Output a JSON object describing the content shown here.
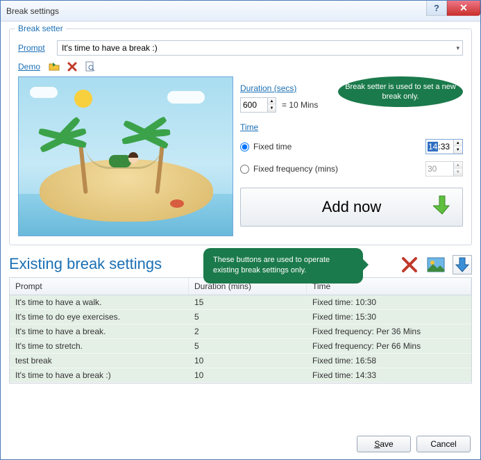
{
  "window": {
    "title": "Break settings"
  },
  "break_setter": {
    "legend": "Break setter",
    "prompt_label": "Prompt",
    "prompt_value": "It's time to have a break :)",
    "demo_label": "Demo",
    "duration_label": "Duration (secs)",
    "duration_value": "600",
    "duration_eq": "= 10 Mins",
    "time_label": "Time",
    "fixed_time_label": "Fixed time",
    "fixed_time_value": "14:33",
    "fixed_time_selected_part": "14",
    "fixed_time_rest": ":33",
    "fixed_freq_label": "Fixed frequency (mins)",
    "fixed_freq_value": "30",
    "selected_radio": "fixed_time",
    "add_button": "Add now",
    "tooltip": "Break setter is used to set a new break only."
  },
  "existing": {
    "heading": "Existing break settings",
    "tooltip": "These buttons are used to operate existing break settings only.",
    "columns": {
      "prompt": "Prompt",
      "duration": "Duration (mins)",
      "time": "Time"
    },
    "rows": [
      {
        "prompt": "It's time to have a walk.",
        "duration": "15",
        "time": "Fixed time: 10:30"
      },
      {
        "prompt": "It's time to do eye exercises.",
        "duration": "5",
        "time": "Fixed time: 15:30"
      },
      {
        "prompt": "It's time to have a break.",
        "duration": "2",
        "time": "Fixed frequency: Per 36 Mins"
      },
      {
        "prompt": "It's time to stretch.",
        "duration": "5",
        "time": "Fixed frequency: Per 66 Mins"
      },
      {
        "prompt": "test break",
        "duration": "10",
        "time": "Fixed time: 16:58"
      },
      {
        "prompt": "It's time to have a break :)",
        "duration": "10",
        "time": "Fixed time: 14:33"
      }
    ]
  },
  "footer": {
    "save": "Save",
    "cancel": "Cancel"
  },
  "colors": {
    "accent": "#1a6fb5",
    "balloon": "#1b7a4b"
  }
}
